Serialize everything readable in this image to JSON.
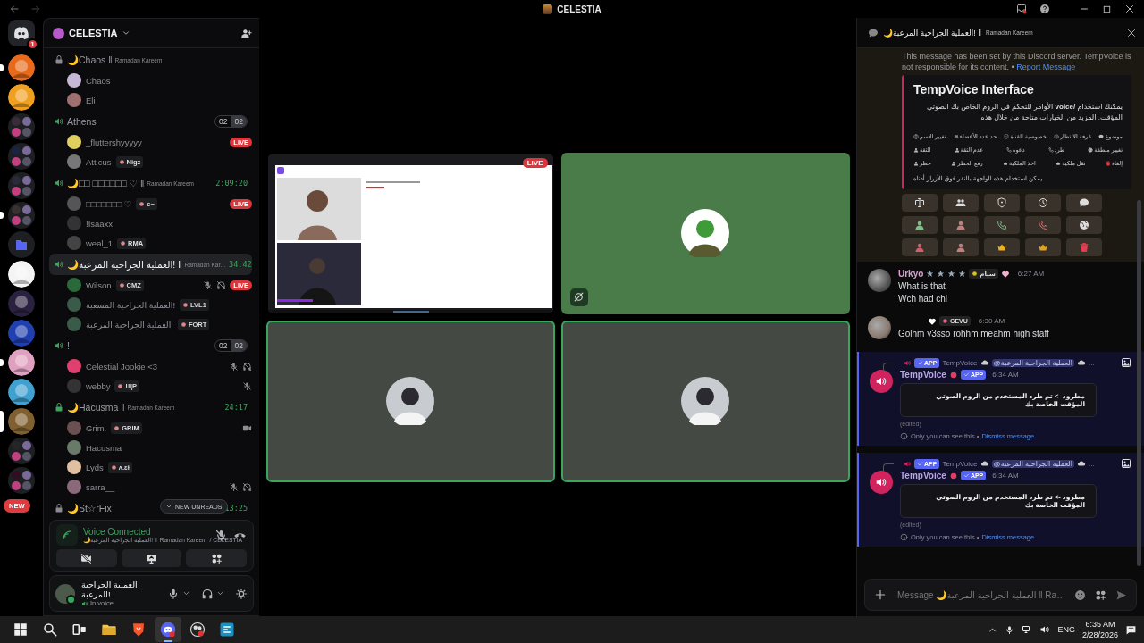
{
  "window": {
    "title": "CELESTIA"
  },
  "server_rail": {
    "home_badge": "1",
    "new_badge": "NEW",
    "servers": [
      {
        "kind": "server",
        "unread": true,
        "selected": false
      },
      {
        "kind": "server",
        "unread": false,
        "selected": false
      },
      {
        "kind": "group",
        "unread": false,
        "selected": false
      },
      {
        "kind": "group",
        "unread": false,
        "selected": false
      },
      {
        "kind": "group",
        "unread": false,
        "selected": false
      },
      {
        "kind": "group",
        "unread": true,
        "selected": false
      },
      {
        "kind": "folder",
        "unread": false,
        "selected": false
      },
      {
        "kind": "server",
        "unread": false,
        "selected": false
      },
      {
        "kind": "server",
        "unread": false,
        "selected": false
      },
      {
        "kind": "server",
        "unread": false,
        "selected": false
      },
      {
        "kind": "server",
        "unread": true,
        "selected": false
      },
      {
        "kind": "server",
        "unread": false,
        "selected": false
      },
      {
        "kind": "server",
        "unread": false,
        "selected": true
      },
      {
        "kind": "group",
        "unread": false,
        "selected": false
      },
      {
        "kind": "group",
        "unread": false,
        "selected": false
      }
    ]
  },
  "server": {
    "name": "CELESTIA"
  },
  "channels": [
    {
      "name": "🌙Chaos ǁ",
      "subtitle": "Ramadan Kareem",
      "locked": true,
      "selected": false,
      "members": [
        {
          "name": "Chaos",
          "muted": false,
          "deafened": false,
          "video": false
        },
        {
          "name": "Eli",
          "muted": false,
          "deafened": false,
          "video": false
        }
      ]
    },
    {
      "name": "Athens",
      "locked": false,
      "selected": false,
      "counts": [
        "02",
        "02"
      ],
      "members": [
        {
          "name": "_fluttershyyyyy",
          "badge": "LIVE",
          "muted": false,
          "deafened": false,
          "video": false
        },
        {
          "name": "Atticus",
          "tag": "Nigz",
          "muted": false,
          "deafened": false,
          "video": false
        }
      ]
    },
    {
      "name": "🌙□□ □□□□□□ ♡ ǁ",
      "subtitle": "Ramadan Kareem",
      "timer": "2:09:20",
      "locked": false,
      "selected": false,
      "members": [
        {
          "name": "□□□□□□□ ♡",
          "tag": "c~",
          "badge": "LIVE",
          "muted": false,
          "deafened": false,
          "video": false
        },
        {
          "name": "!Isaaxx",
          "muted": false,
          "deafened": false,
          "video": false
        },
        {
          "name": "weal_1",
          "tag": "RMA",
          "muted": false,
          "deafened": false,
          "video": false
        }
      ]
    },
    {
      "name": "🌙العملية الجراحية المرعبة! ǁ",
      "subtitle": "Ramadan Kar…",
      "timer": "34:42",
      "locked": false,
      "selected": true,
      "members": [
        {
          "name": "Wilson",
          "tag": "CMZ",
          "badge": "LIVE",
          "muted": true,
          "deafened": true,
          "video": false
        },
        {
          "name": "العملية الجراحية المسعبة!",
          "tag": "LVL1",
          "muted": false,
          "deafened": false,
          "video": false
        },
        {
          "name": "العملية الجراحية المرعبة!",
          "tag": "FORT",
          "muted": false,
          "deafened": false,
          "video": false
        }
      ]
    },
    {
      "name": "!",
      "locked": false,
      "selected": false,
      "counts": [
        "02",
        "02"
      ],
      "members": [
        {
          "name": "Celestial Jookie <3",
          "muted": true,
          "deafened": true,
          "video": false
        },
        {
          "name": "webby",
          "tag": "ЩP",
          "muted": true,
          "deafened": false,
          "video": false
        }
      ]
    },
    {
      "name": "🌙Hacusma ǁ",
      "subtitle": "Ramadan Kareem",
      "timer": "24:17",
      "locked": true,
      "selected": false,
      "members": [
        {
          "name": "Grim.",
          "tag": "GRIM",
          "muted": false,
          "deafened": false,
          "video": true
        },
        {
          "name": "Hacusma",
          "muted": false,
          "deafened": false,
          "video": false
        },
        {
          "name": "Lyds",
          "tag": "ᴧ.ɛɨ",
          "muted": false,
          "deafened": false,
          "video": false
        },
        {
          "name": "sarra__",
          "muted": true,
          "deafened": true,
          "video": false
        }
      ]
    },
    {
      "name": "🌙St☆rFix",
      "timer": "13:25",
      "locked": true,
      "selected": false
    }
  ],
  "new_unreads": "NEW UNREADS",
  "voice_panel": {
    "status": "Voice Connected",
    "channel": "🌙العملية الجراحية المرعبة! ǁ",
    "note": "Ramadan Kareem",
    "server": "/ CELESTIA"
  },
  "user_panel": {
    "name": "العملية الجراحية المرعبة!",
    "status": "In voice"
  },
  "stage": {
    "tiles": [
      {
        "kind": "stream",
        "badge": "LIVE",
        "speaking": false,
        "video_off": false
      },
      {
        "kind": "avatar",
        "color": "#4a7c4a",
        "speaking": false,
        "video_off": true
      },
      {
        "kind": "avatar",
        "color": "#444944",
        "speaking": true,
        "video_off": false
      },
      {
        "kind": "avatar",
        "color": "#444944",
        "speaking": true,
        "video_off": false
      }
    ]
  },
  "chat": {
    "title": "🌙العملية الجراحية المرعبة! ǁ",
    "note": "Ramadan Kareem",
    "notice": {
      "text": "This message has been set by this Discord server. TempVoice is not responsible for its content. •",
      "link": "Report Message"
    },
    "embed": {
      "title": "TempVoice Interface",
      "description": "يمكنك استخدام **/voice** الأوامر للتحكم في الروم الخاص بك الصوتي المؤقت. المزيد من الخيارات متاحة من خلال هذه",
      "option_rows": [
        [
          "موضوع",
          "غرفة الانتظار",
          "خصوصية القناة",
          "حد عدد الأعضاء",
          "تغيير الاسم"
        ],
        [
          "تغيير منطقة",
          "طرد",
          "دعوة",
          "عدم الثقة",
          "الثقة"
        ],
        [
          "إلغاء",
          "نقل ملكية",
          "اخذ الملكية",
          "رفع الحظر",
          "حظر"
        ]
      ],
      "footer": "يمكن استخدام هذه الواجهة بالنقر فوق الأزرار أدناه"
    },
    "messages": [
      {
        "kind": "user",
        "author": "Urkyo",
        "tag": "سيام",
        "time": "6:27 AM",
        "lines": [
          "What is that",
          "Wch had chi"
        ]
      },
      {
        "kind": "user",
        "tag": "GEVU",
        "time": "6:30 AM",
        "lines": [
          "Golhm y3sso rohhm meahm high staff"
        ]
      },
      {
        "kind": "app",
        "reply": {
          "badge": "APP",
          "author": "TempVoice",
          "mention": "@العملية الجراحية المرعبة",
          "more": "..."
        },
        "author": "TempVoice",
        "badge": "APP",
        "time": "6:34 AM",
        "text": "مطرود -> تم طرد المستخدم من الروم الصوتي المؤقت الخاصة بك",
        "edited": "(edited)",
        "note": "Only you can see this •",
        "link": "Dismiss message"
      },
      {
        "kind": "app",
        "reply": {
          "badge": "APP",
          "author": "TempVoice",
          "mention": "@العملية الجراحية المرعبة",
          "more": "..."
        },
        "author": "TempVoice",
        "badge": "APP",
        "time": "6:34 AM",
        "text": "مطرود -> تم طرد المستخدم من الروم الصوتي المؤقت الخاصة بك",
        "edited": "(edited)",
        "note": "Only you can see this •",
        "link": "Dismiss message"
      }
    ],
    "composer": {
      "placeholder": "Message 🌙العملية الجراحية المرعبة ǁ Ra…"
    }
  },
  "taskbar": {
    "apps": [
      {
        "kind": "start",
        "selected": false
      },
      {
        "kind": "search",
        "selected": false
      },
      {
        "kind": "taskview",
        "selected": false
      },
      {
        "kind": "explorer",
        "selected": false
      },
      {
        "kind": "browser",
        "selected": false
      },
      {
        "kind": "discord",
        "selected": true
      },
      {
        "kind": "recorder",
        "selected": false
      },
      {
        "kind": "app",
        "selected": false
      }
    ],
    "language": "ENG",
    "time": "6:35 AM",
    "date": "2/28/2026"
  }
}
